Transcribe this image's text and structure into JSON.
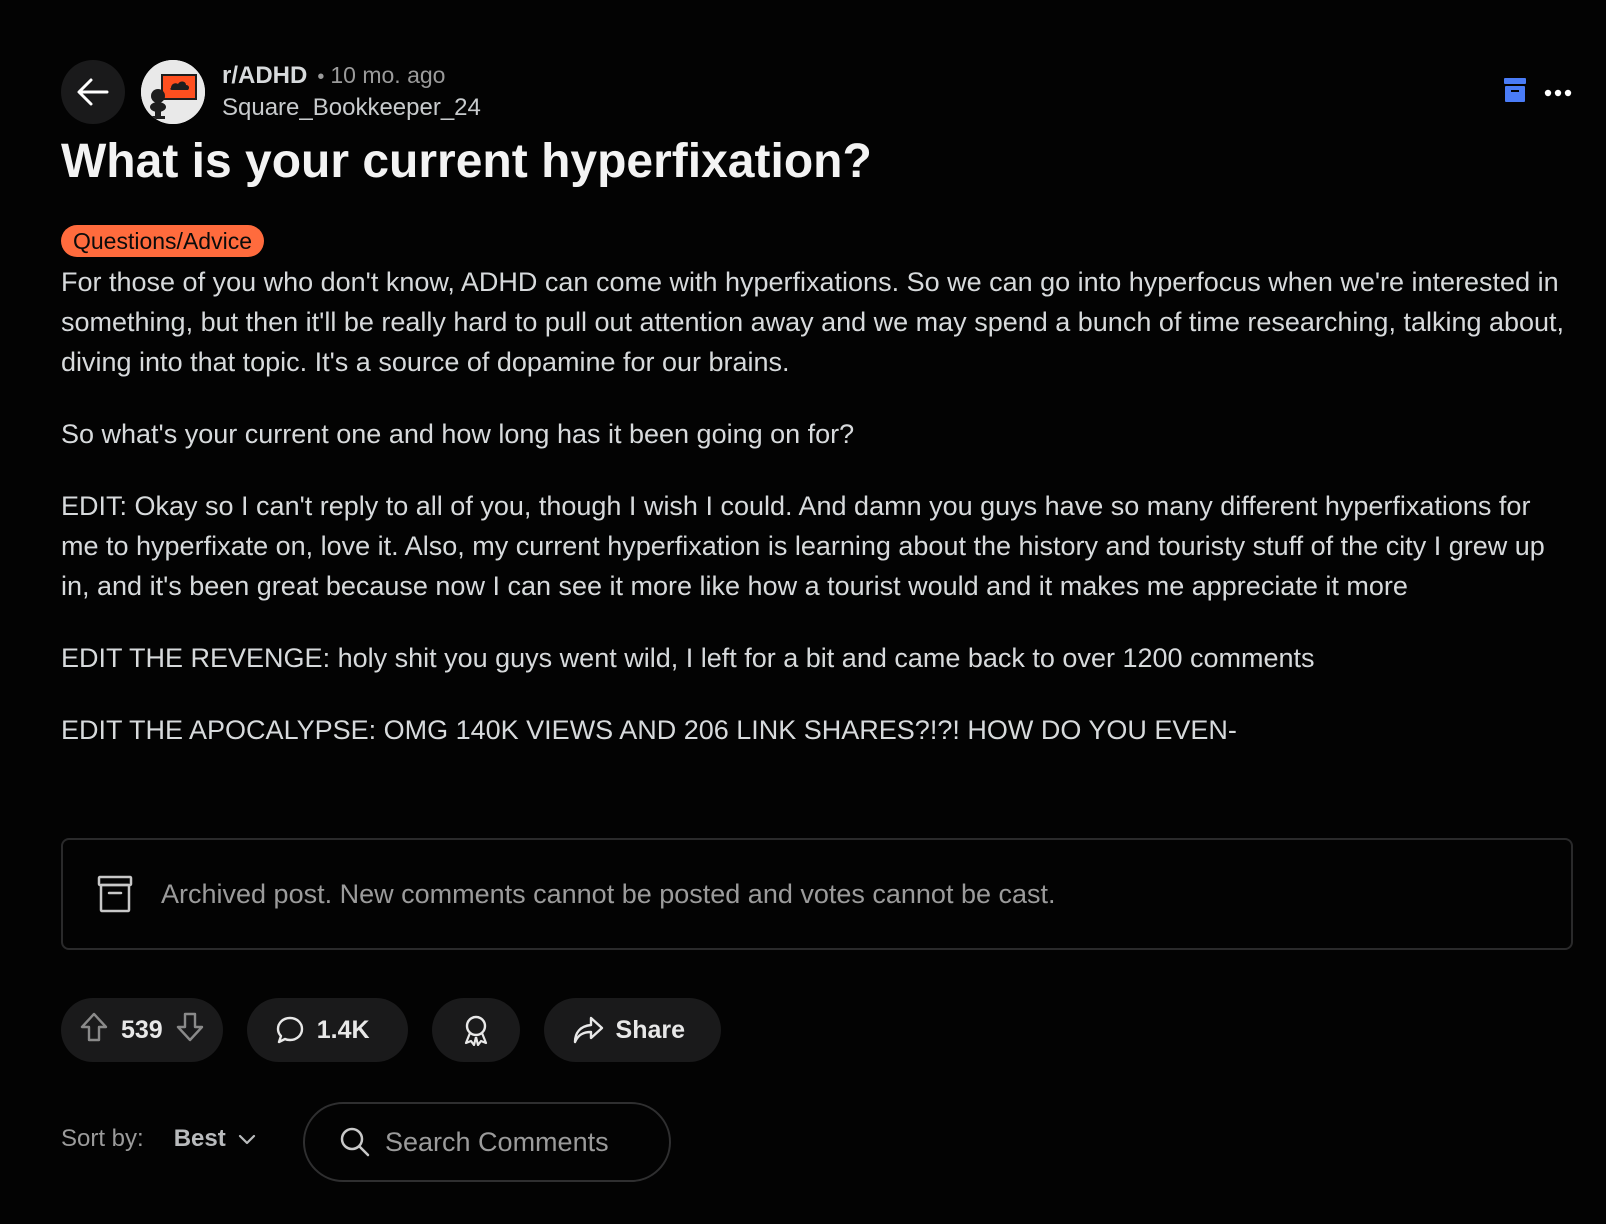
{
  "header": {
    "subreddit": "r/ADHD",
    "separator": "•",
    "age": "10 mo. ago",
    "author": "Square_Bookkeeper_24"
  },
  "post": {
    "title": "What is your current hyperfixation?",
    "flair": "Questions/Advice",
    "flair_color": "#ff6b3d",
    "paragraphs": [
      "For those of you who don't know, ADHD can come with hyperfixations. So we can go into hyperfocus when we're interested in something, but then it'll be really hard to pull out attention away and we may spend a bunch of time researching, talking about, diving into that topic. It's a source of dopamine for our brains.",
      "So what's your current one and how long has it been going on for?",
      "EDIT: Okay so I can't reply to all of you, though I wish I could. And damn you guys have so many different hyperfixations for me to hyperfixate on, love it. Also, my current hyperfixation is learning about the history and touristy stuff of the city I grew up in, and it's been great because now I can see it more like how a tourist would and it makes me appreciate it more",
      "EDIT THE REVENGE: holy shit you guys went wild, I left for a bit and came back to over 1200 comments",
      "EDIT THE APOCALYPSE: OMG 140K VIEWS AND 206 LINK SHARES?!?! HOW DO YOU EVEN-"
    ]
  },
  "archived_notice": "Archived post. New comments cannot be posted and votes cannot be cast.",
  "actions": {
    "score": "539",
    "comments": "1.4K",
    "share_label": "Share"
  },
  "sort": {
    "label": "Sort by:",
    "value": "Best"
  },
  "search": {
    "placeholder": "Search Comments"
  },
  "icons": {
    "back": "arrow-left-icon",
    "archive": "archive-icon",
    "more": "ellipsis-icon",
    "upvote": "arrow-up-icon",
    "downvote": "arrow-down-icon",
    "comment": "speech-bubble-icon",
    "award": "award-icon",
    "share": "share-arrow-icon",
    "search": "magnifier-icon"
  },
  "colors": {
    "background": "#030303",
    "accent_archive": "#4a7cf7"
  }
}
